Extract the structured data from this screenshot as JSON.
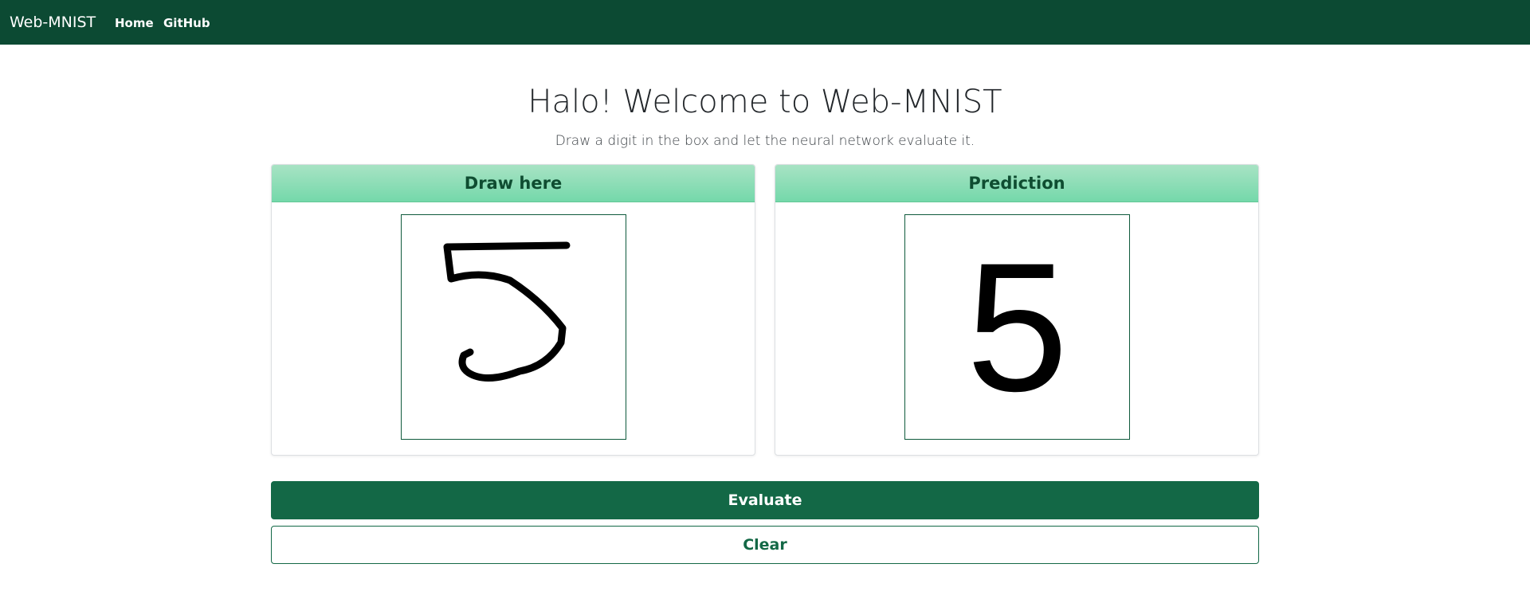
{
  "navbar": {
    "brand": "Web-MNIST",
    "links": [
      {
        "label": "Home"
      },
      {
        "label": "GitHub"
      }
    ]
  },
  "hero": {
    "title": "Halo! Welcome to Web-MNIST",
    "subtitle": "Draw a digit in the box and let the neural network evaluate it."
  },
  "draw_card": {
    "header": "Draw here"
  },
  "prediction_card": {
    "header": "Prediction",
    "digit": "5"
  },
  "actions": {
    "evaluate_label": "Evaluate",
    "clear_label": "Clear"
  },
  "colors": {
    "navbar": "#0c4a33",
    "accent": "#136846",
    "card_header": "#74d8aa"
  }
}
